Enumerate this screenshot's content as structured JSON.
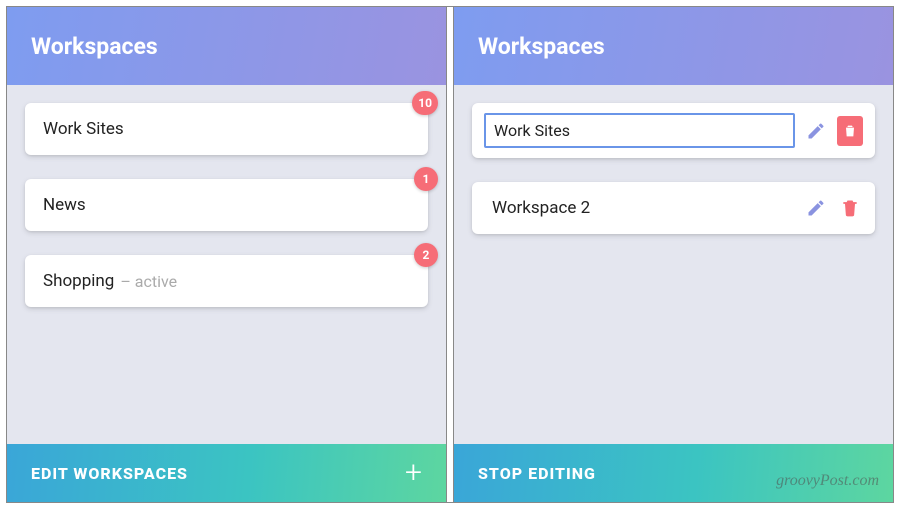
{
  "left": {
    "title": "Workspaces",
    "items": [
      {
        "label": "Work Sites",
        "badge": "10",
        "active": false
      },
      {
        "label": "News",
        "badge": "1",
        "active": false
      },
      {
        "label": "Shopping",
        "badge": "2",
        "active": true,
        "active_text": "– active"
      }
    ],
    "footer_label": "EDIT WORKSPACES",
    "add_icon": "+"
  },
  "right": {
    "title": "Workspaces",
    "items": [
      {
        "label": "Work Sites",
        "editing": true
      },
      {
        "label": "Workspace 2",
        "editing": false
      }
    ],
    "footer_label": "STOP EDITING"
  },
  "colors": {
    "badge": "#f66d77",
    "pencil": "#8a93e0",
    "trash": "#f66d77",
    "input_border": "#6a95e8"
  },
  "watermark": "groovyPost.com"
}
